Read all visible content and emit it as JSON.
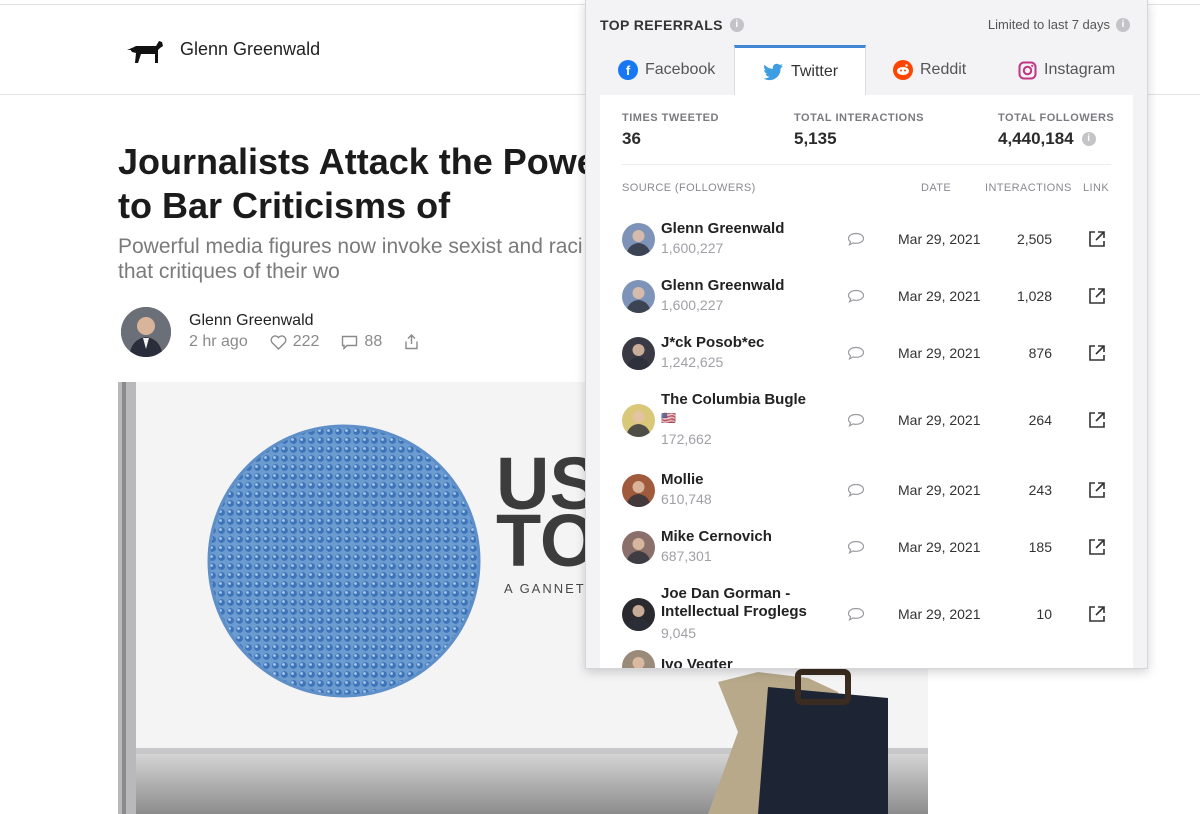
{
  "site": {
    "name": "Glenn Greenwald",
    "logo_icon": "dog-silhouette-icon"
  },
  "article": {
    "headline": "Journalists Attack the Powerl Victimize to Bar Criticisms of",
    "subtitle": "Powerful media figures now invoke sexist and raci fragile and marginalized that critiques of their wo",
    "author": "Glenn Greenwald",
    "time": "2 hr ago",
    "likes": "222",
    "comments": "88",
    "hero_text_1": "US",
    "hero_text_2": "TO",
    "hero_text_3": "A GANNETT"
  },
  "referrals": {
    "title": "TOP REFERRALS",
    "limit": "Limited to last 7 days",
    "tabs": [
      {
        "label": "Facebook",
        "icon": "facebook-icon",
        "color": "#1877f2"
      },
      {
        "label": "Twitter",
        "icon": "twitter-icon",
        "color": "#3f9de4",
        "active": true
      },
      {
        "label": "Reddit",
        "icon": "reddit-icon",
        "color": "#ff4500"
      },
      {
        "label": "Instagram",
        "icon": "instagram-icon",
        "color": "#c13584"
      }
    ],
    "stats": {
      "times_tweeted_label": "TIMES TWEETED",
      "times_tweeted": "36",
      "interactions_label": "TOTAL INTERACTIONS",
      "interactions": "5,135",
      "followers_label": "TOTAL FOLLOWERS",
      "followers": "4,440,184"
    },
    "columns": {
      "source": "SOURCE (FOLLOWERS)",
      "date": "DATE",
      "interactions": "INTERACTIONS",
      "link": "LINK"
    },
    "rows": [
      {
        "name": "Glenn Greenwald",
        "followers": "1,600,227",
        "date": "Mar 29, 2021",
        "interactions": "2,505"
      },
      {
        "name": "Glenn Greenwald",
        "followers": "1,600,227",
        "date": "Mar 29, 2021",
        "interactions": "1,028"
      },
      {
        "name": "J*ck Posob*ec",
        "followers": "1,242,625",
        "date": "Mar 29, 2021",
        "interactions": "876"
      },
      {
        "name": "The Columbia Bugle",
        "flag": "🇺🇸",
        "followers": "172,662",
        "date": "Mar 29, 2021",
        "interactions": "264"
      },
      {
        "name": "Mollie",
        "followers": "610,748",
        "date": "Mar 29, 2021",
        "interactions": "243"
      },
      {
        "name": "Mike Cernovich",
        "followers": "687,301",
        "date": "Mar 29, 2021",
        "interactions": "185"
      },
      {
        "name": "Joe Dan Gorman - Intellectual Froglegs",
        "followers": "9,045",
        "date": "Mar 29, 2021",
        "interactions": "10"
      },
      {
        "name": "Ivo Vegter"
      }
    ]
  }
}
